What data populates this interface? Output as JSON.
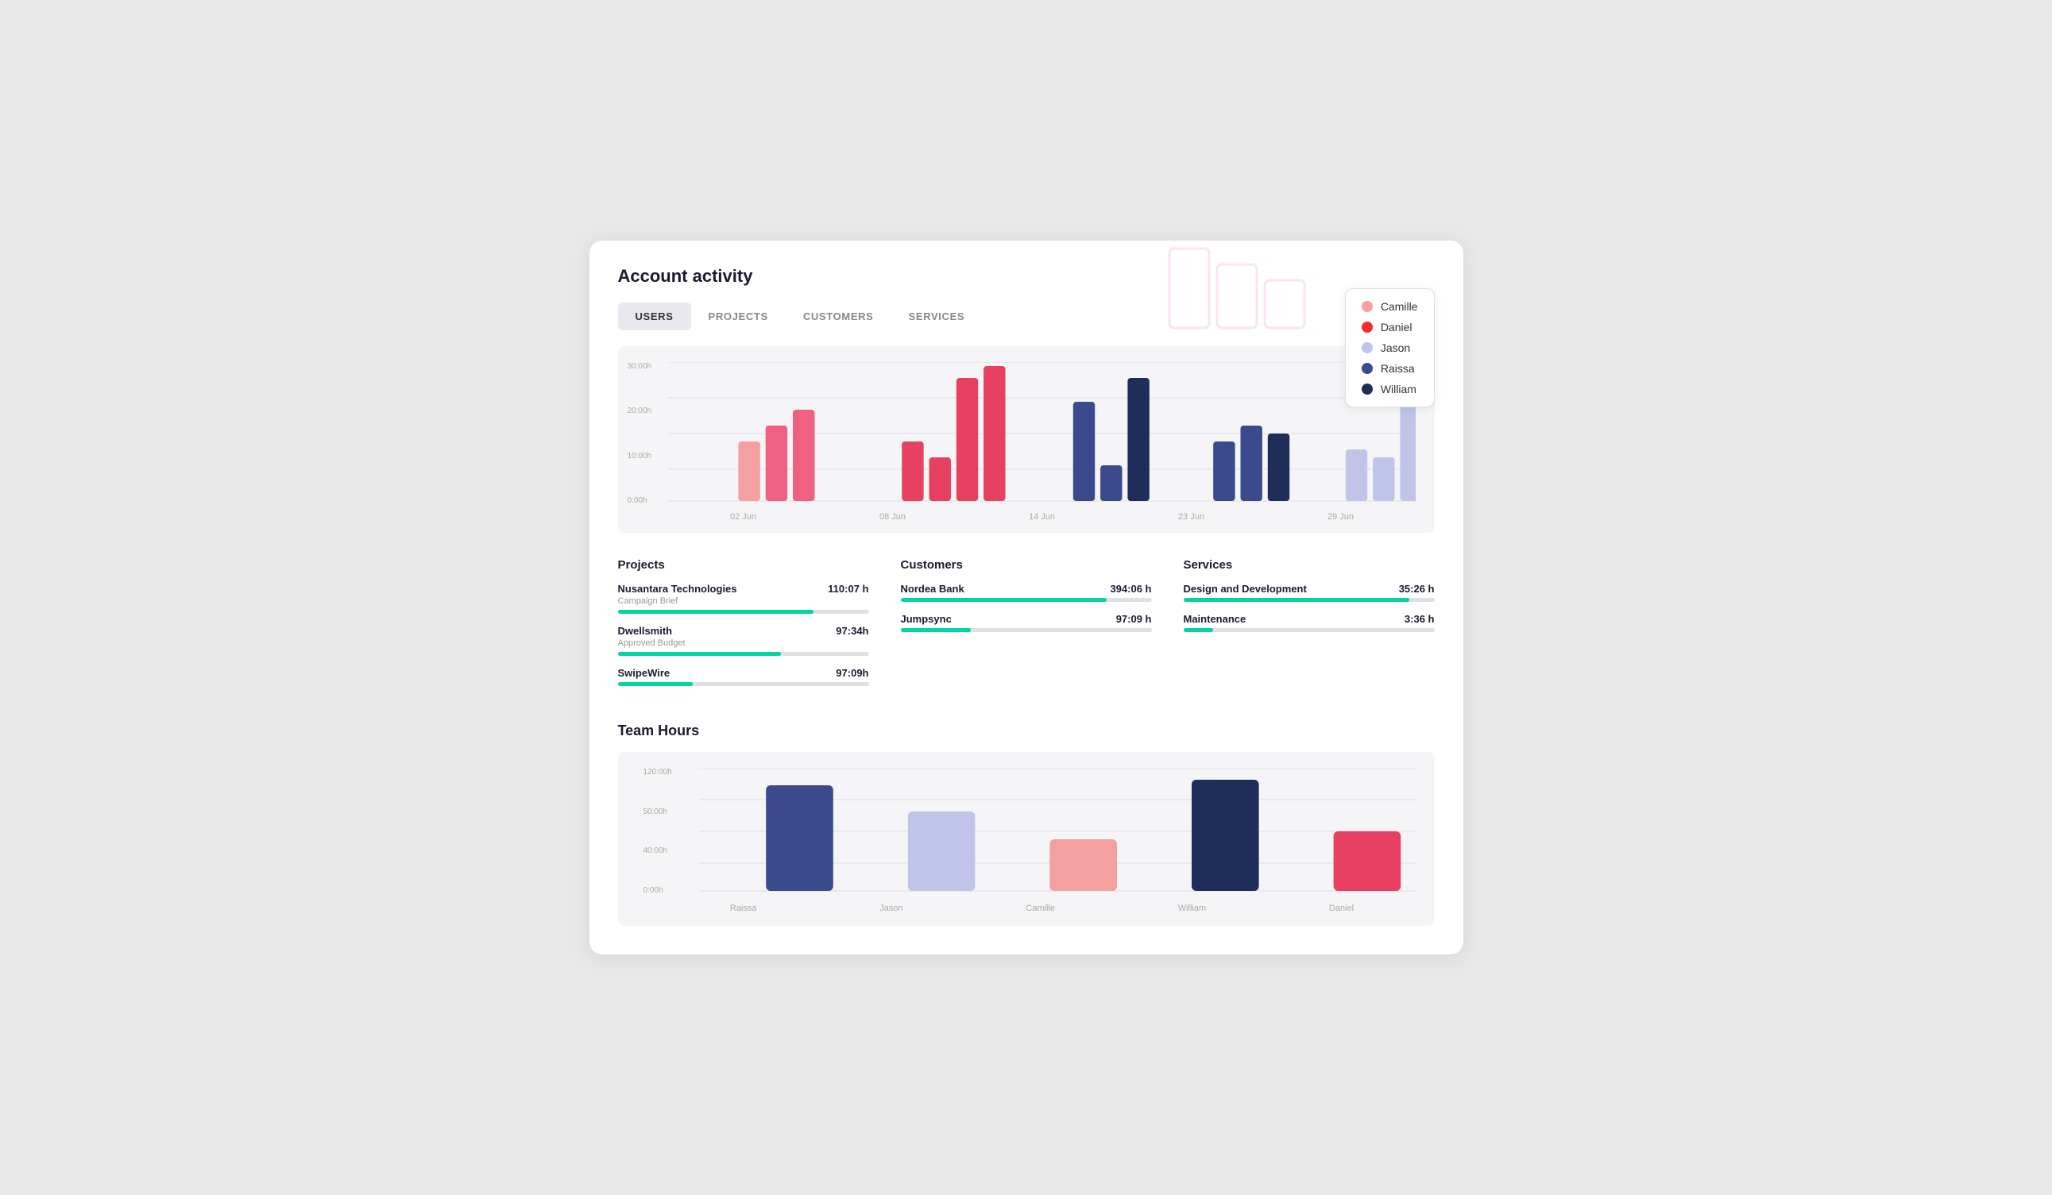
{
  "page": {
    "title": "Account activity"
  },
  "tabs": [
    {
      "label": "USERS",
      "active": true
    },
    {
      "label": "PROJECTS",
      "active": false
    },
    {
      "label": "CUSTOMERS",
      "active": false
    },
    {
      "label": "SERVICES",
      "active": false
    }
  ],
  "legend": {
    "items": [
      {
        "name": "Camille",
        "color": "#f4a0a0"
      },
      {
        "name": "Daniel",
        "color": "#f03030"
      },
      {
        "name": "Jason",
        "color": "#c0c4e8"
      },
      {
        "name": "Raissa",
        "color": "#3b4a8c"
      },
      {
        "name": "William",
        "color": "#1e2d5a"
      }
    ]
  },
  "chart": {
    "y_labels": [
      "30:00h",
      "20:00h",
      "10:00h",
      "0:00h"
    ],
    "x_labels": [
      "02 Jun",
      "08 Jun",
      "14 Jun",
      "23 Jun",
      "29 Jun"
    ]
  },
  "stats": {
    "projects": {
      "title": "Projects",
      "items": [
        {
          "name": "Nusantara Technologies",
          "sub": "Campaign Brief",
          "hours": "110:07 h",
          "pct": 78
        },
        {
          "name": "Dwellsmith",
          "sub": "Approved Budget",
          "hours": "97:34h",
          "pct": 65
        },
        {
          "name": "SwipeWire",
          "sub": "",
          "hours": "97:09h",
          "pct": 30
        }
      ]
    },
    "customers": {
      "title": "Customers",
      "items": [
        {
          "name": "Nordea Bank",
          "sub": "",
          "hours": "394:06 h",
          "pct": 82
        },
        {
          "name": "Jumpsync",
          "sub": "",
          "hours": "97:09 h",
          "pct": 28
        }
      ]
    },
    "services": {
      "title": "Services",
      "items": [
        {
          "name": "Design and Development",
          "sub": "",
          "hours": "35:26 h",
          "pct": 90
        },
        {
          "name": "Maintenance",
          "sub": "",
          "hours": "3:36 h",
          "pct": 12
        }
      ]
    }
  },
  "team_hours": {
    "title": "Team Hours",
    "y_labels": [
      "120:00h",
      "50:00h",
      "40:00h",
      "0:00h"
    ],
    "members": [
      {
        "name": "Raissa",
        "color": "#3b4a8c",
        "height_pct": 85
      },
      {
        "name": "Jason",
        "color": "#c0c4e8",
        "height_pct": 62
      },
      {
        "name": "Camille",
        "color": "#f4a0a0",
        "height_pct": 38
      },
      {
        "name": "William",
        "color": "#1e2d5a",
        "height_pct": 80
      },
      {
        "name": "Daniel",
        "color": "#e84060",
        "height_pct": 45
      }
    ]
  }
}
